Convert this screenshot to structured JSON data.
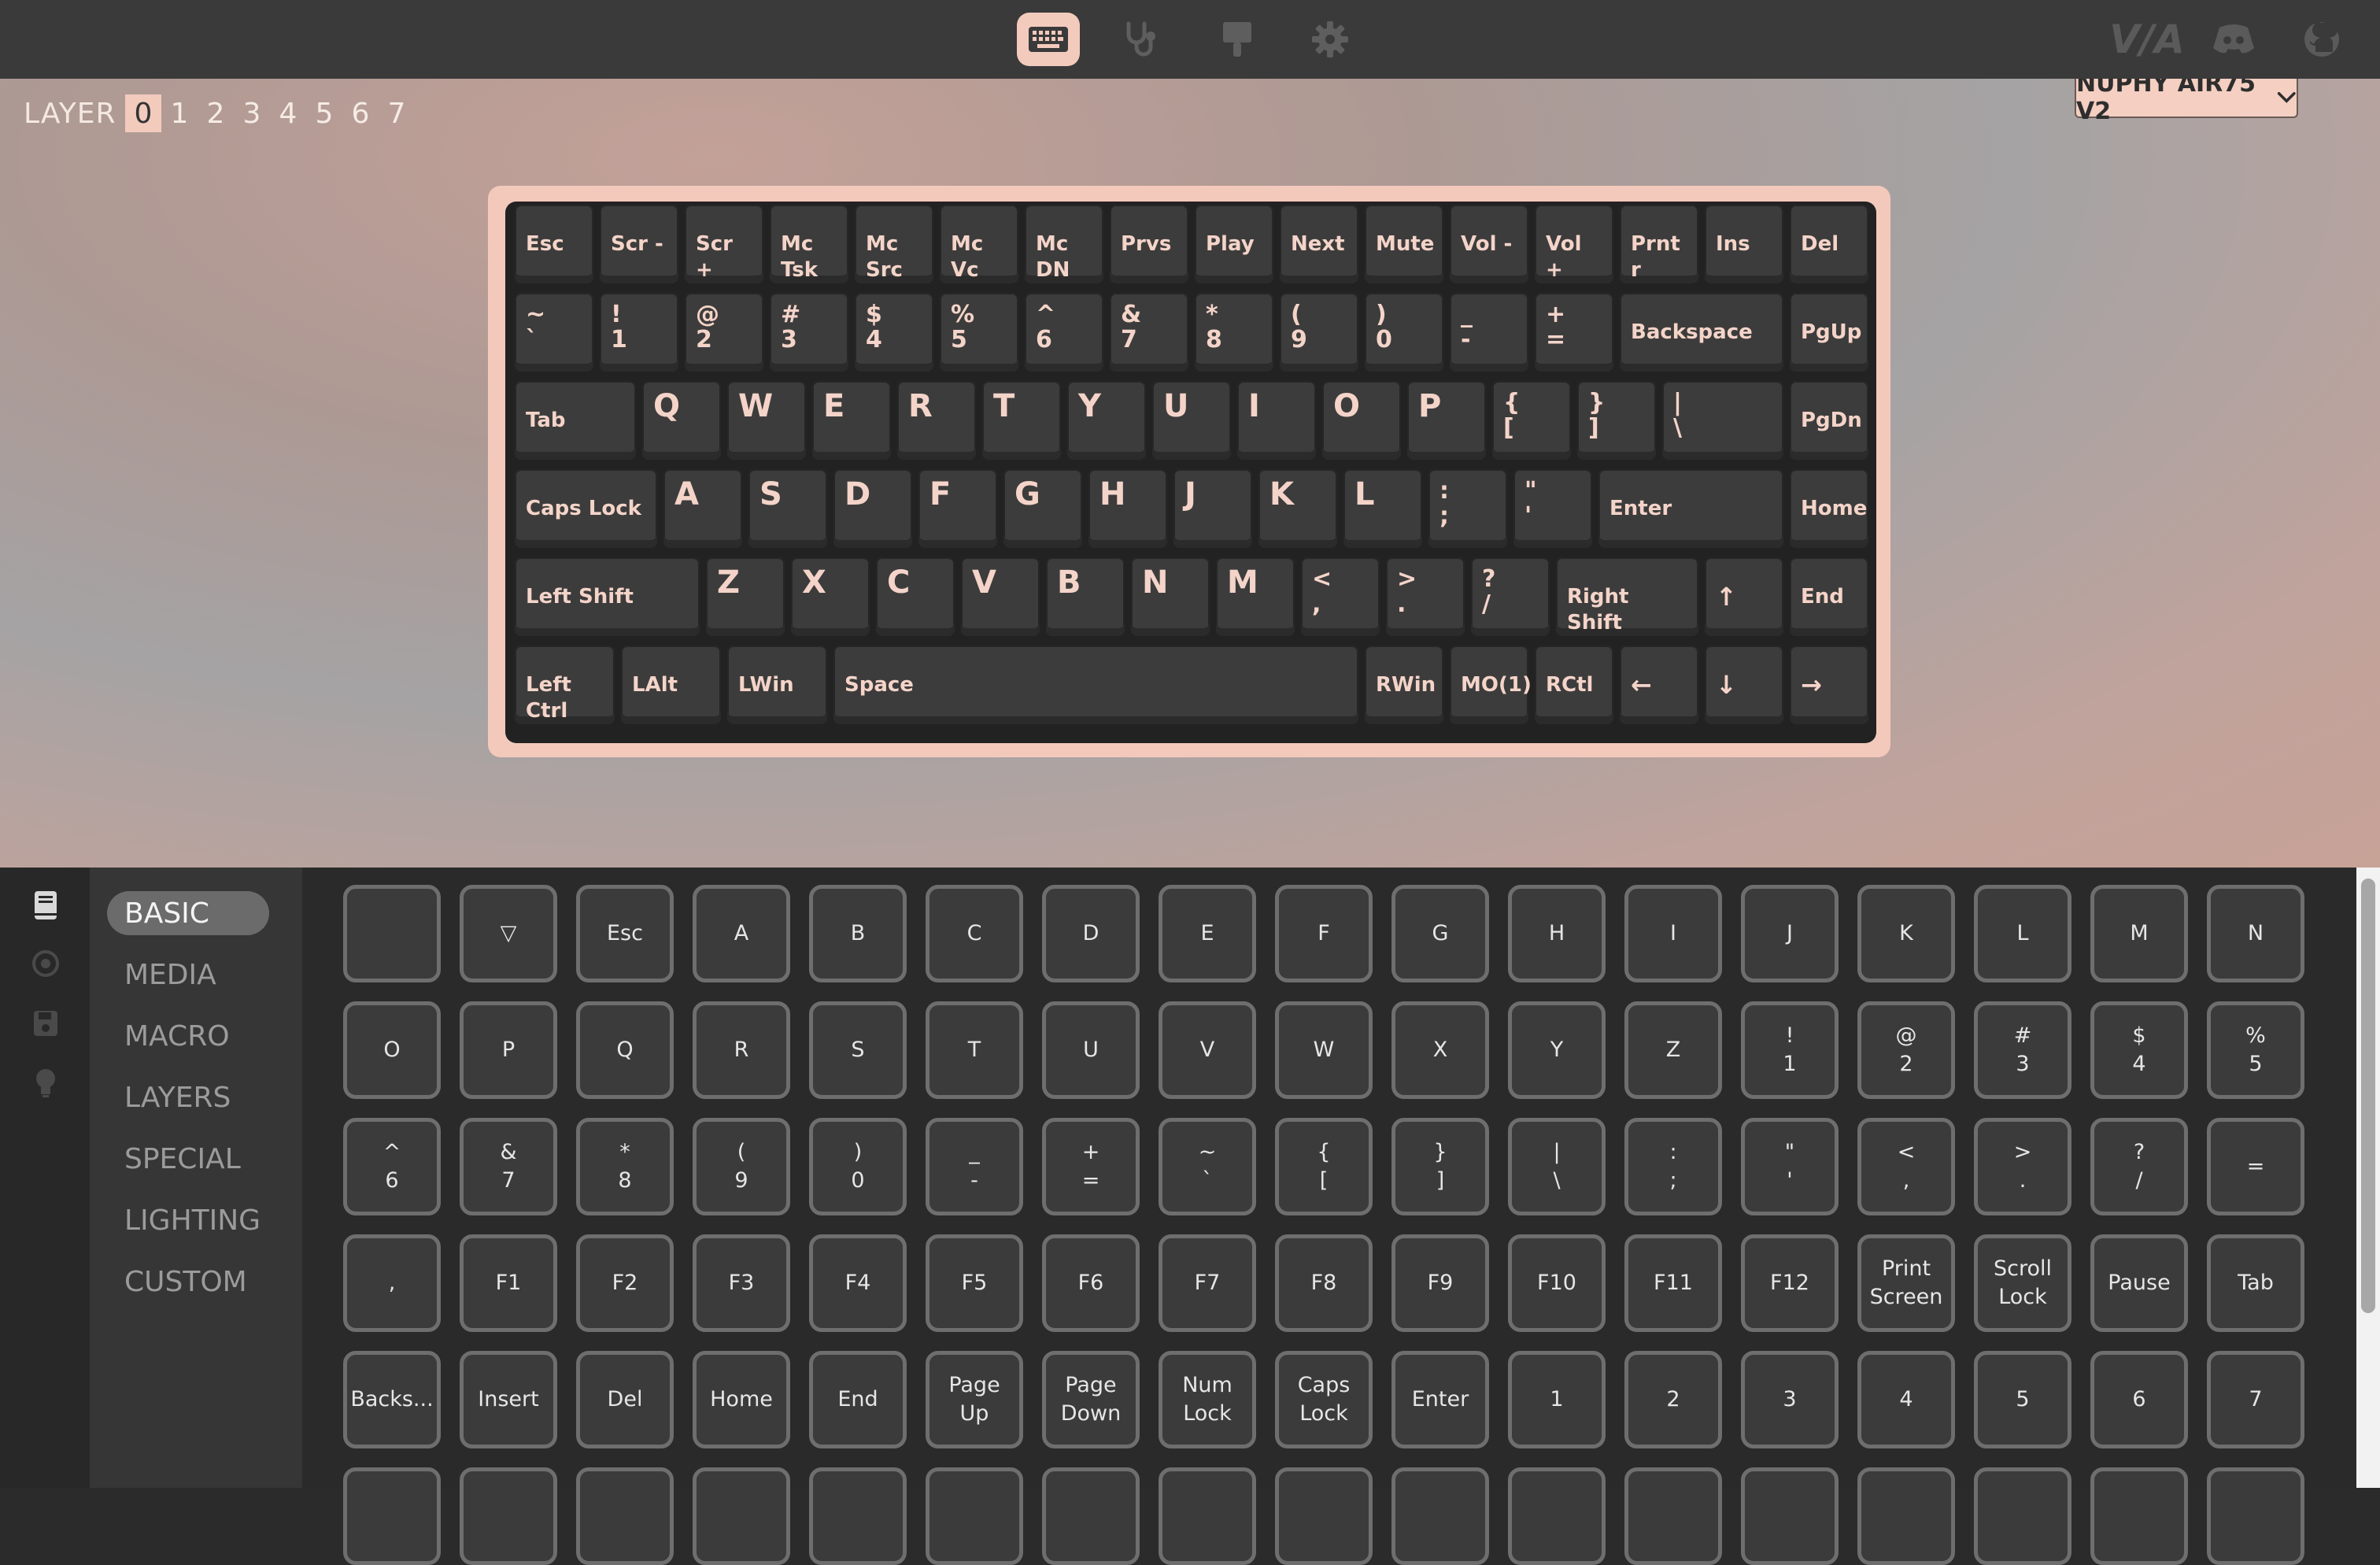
{
  "topbar": {
    "nav": [
      {
        "name": "keyboard-icon",
        "active": true
      },
      {
        "name": "stethoscope-icon",
        "active": false
      },
      {
        "name": "paintbrush-icon",
        "active": false
      },
      {
        "name": "gear-icon",
        "active": false
      }
    ],
    "brand_text": "V/A",
    "brand_icons": [
      "discord-icon",
      "github-icon"
    ]
  },
  "layers": {
    "label": "LAYER",
    "items": [
      "0",
      "1",
      "2",
      "3",
      "4",
      "5",
      "6",
      "7"
    ],
    "active": "0"
  },
  "device": {
    "label": "NUPHY AIR75 V2",
    "icon": "chevron-down-icon"
  },
  "keyboard": {
    "rows": [
      [
        "Esc",
        "Scr -",
        "Scr +",
        "Mc Tsk",
        "Mc Src",
        "Mc Vc",
        "Mc DN",
        "Prvs",
        "Play",
        "Next",
        "Mute",
        "Vol -",
        "Vol +",
        "Prnt r",
        "Ins",
        "Del"
      ],
      [
        "~\n`",
        "!\n1",
        "@\n2",
        "#\n3",
        "$\n4",
        "%\n5",
        "^\n6",
        "&\n7",
        "*\n8",
        "(\n9",
        ")\n0",
        "_\n-",
        "+\n=",
        "Backspace",
        "PgUp"
      ],
      [
        "Tab",
        "Q",
        "W",
        "E",
        "R",
        "T",
        "Y",
        "U",
        "I",
        "O",
        "P",
        "{\n[",
        "}\n]",
        "|\n\\",
        "PgDn"
      ],
      [
        "Caps Lock",
        "A",
        "S",
        "D",
        "F",
        "G",
        "H",
        "J",
        "K",
        "L",
        ":\n;",
        "\"\n'",
        "Enter",
        "Home"
      ],
      [
        "Left Shift",
        "Z",
        "X",
        "C",
        "V",
        "B",
        "N",
        "M",
        "<\n,",
        ">\n.",
        "?\n/",
        "Right Shift",
        "↑",
        "End"
      ],
      [
        "Left Ctrl",
        "LAlt",
        "LWin",
        "Space",
        "RWin",
        "MO(1)",
        "RCtl",
        "←",
        "↓",
        "→"
      ]
    ]
  },
  "sidebar_icons": [
    "book-icon",
    "record-icon",
    "save-icon",
    "lightbulb-icon"
  ],
  "menu": {
    "items": [
      "BASIC",
      "MEDIA",
      "MACRO",
      "LAYERS",
      "SPECIAL",
      "LIGHTING",
      "CUSTOM"
    ],
    "active": "BASIC"
  },
  "keycodes": [
    [
      "",
      "▽",
      "Esc",
      "A",
      "B",
      "C",
      "D",
      "E",
      "F",
      "G",
      "H",
      "I",
      "J",
      "K",
      "L",
      "M",
      "N"
    ],
    [
      "O",
      "P",
      "Q",
      "R",
      "S",
      "T",
      "U",
      "V",
      "W",
      "X",
      "Y",
      "Z",
      "!\n1",
      "@\n2",
      "#\n3",
      "$\n4",
      "%\n5"
    ],
    [
      "^\n6",
      "&\n7",
      "*\n8",
      "(\n9",
      ")\n0",
      "_\n-",
      "+\n=",
      "~\n`",
      "{\n[",
      "}\n]",
      "|\n\\",
      ":\n;",
      "\"\n'",
      "<\n,",
      ">\n.",
      "?\n/",
      "="
    ],
    [
      ",",
      "F1",
      "F2",
      "F3",
      "F4",
      "F5",
      "F6",
      "F7",
      "F8",
      "F9",
      "F10",
      "F11",
      "F12",
      "Print\nScreen",
      "Scroll\nLock",
      "Pause",
      "Tab"
    ],
    [
      "Backs...",
      "Insert",
      "Del",
      "Home",
      "End",
      "Page\nUp",
      "Page\nDown",
      "Num\nLock",
      "Caps\nLock",
      "Enter",
      "1",
      "2",
      "3",
      "4",
      "5",
      "6",
      "7"
    ],
    [
      "",
      "",
      "",
      "",
      "",
      "",
      "",
      "",
      "",
      "",
      "",
      "",
      "",
      "",
      "",
      "",
      ""
    ]
  ]
}
